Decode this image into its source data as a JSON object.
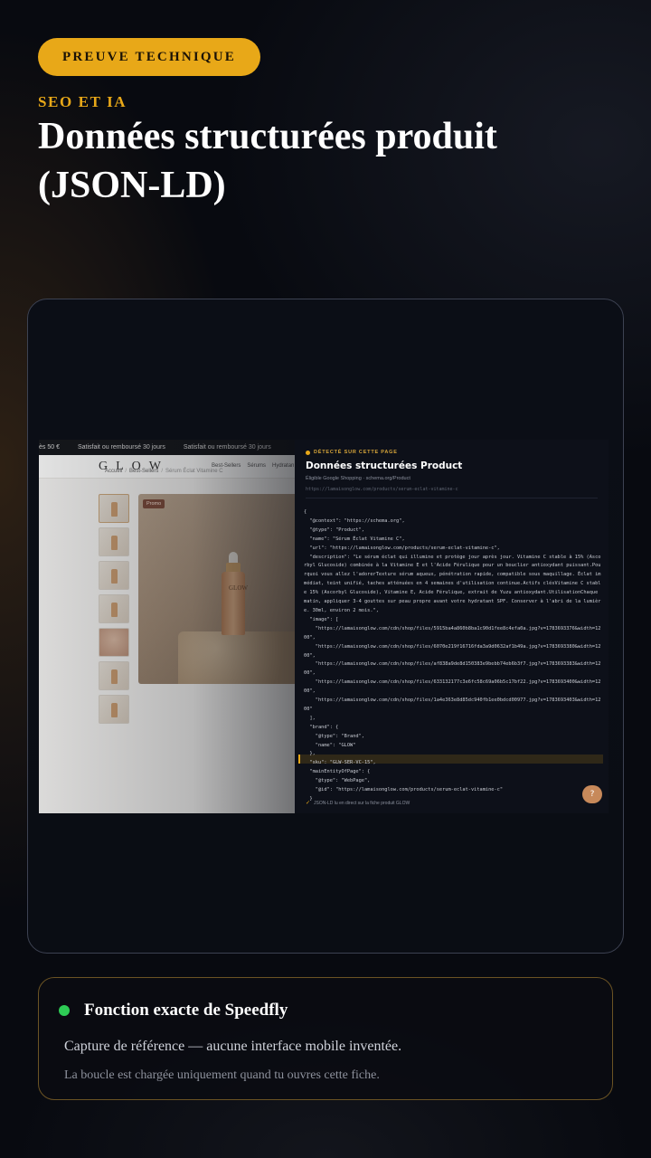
{
  "header": {
    "pill": "PREUVE TECHNIQUE",
    "eyebrow": "SEO ET IA",
    "title": "Données structurées produit (JSON-LD)"
  },
  "site": {
    "announce": [
      "ès 50 €",
      "Satisfait ou remboursé 30 jours",
      "Satisfait ou remboursé 30 jours"
    ],
    "logo": "GLOW",
    "nav": [
      "Best-Sellers",
      "Sérums",
      "Hydratan"
    ],
    "breadcrumb": [
      "Accueil",
      "Best-Sellers",
      "Sérum Éclat Vitamine C"
    ],
    "promo_badge": "Promo",
    "bottle_label": "GLOW"
  },
  "panel": {
    "detected_label": "DÉTECTÉ SUR CETTE PAGE",
    "title": "Données structurées Product",
    "subtitle": "Éligible Google Shopping · schema.org/Product",
    "url": "https://lamaisonglow.com/products/serum-eclat-vitamine-c",
    "json_text": "{\n  \"@context\": \"https://schema.org\",\n  \"@type\": \"Product\",\n  \"name\": \"Sérum Éclat Vitamine C\",\n  \"url\": \"https://lamaisonglow.com/products/serum-eclat-vitamine-c\",\n  \"description\": \"Le sérum éclat qui illumine et protège jour après jour. Vitamine C stable à 15% (Ascorbyl Glucoside) combinée à la Vitamine E et l'Acide Férulique pour un bouclier antioxydant puissant.Pourquoi vous allez l'adorerTexture sérum aqueux, pénétration rapide, compatible sous maquillage. Éclat immédiat, teint unifié, taches atténuées en 4 semaines d'utilisation continue.Actifs clésVitamine C stable 15% (Ascorbyl Glucoside), Vitamine E, Acide Férulique, extrait de Yuzu antioxydant.UtilisationChaque matin, appliquer 3-4 gouttes sur peau propre avant votre hydratant SPF. Conserver à l'abri de la lumière. 30ml, environ 2 mois.\",\n  \"image\": [\n    \"https://lamaisonglow.com/cdn/shop/files/5915ba4a860b8ba1c90d1fee8c4efa0a.jpg?v=1783693376&width=1200\",\n    \"https://lamaisonglow.com/cdn/shop/files/6070e219f16716fda3a9d0632af1b49a.jpg?v=1783693380&width=1200\",\n    \"https://lamaisonglow.com/cdn/shop/files/af838a9de8d150383e9bebb74eb6b3f7.jpg?v=1783693383&width=1200\",\n    \"https://lamaisonglow.com/cdn/shop/files/633132177c3e6fc58c69a06b5c17bf22.jpg?v=1783693400&width=1200\",\n    \"https://lamaisonglow.com/cdn/shop/files/1a4e363e8d85dc940fb1ee0bdcd00977.jpg?v=1783693403&width=1200\"\n  ],\n  \"brand\": {\n    \"@type\": \"Brand\",\n    \"name\": \"GLOW\"\n  },\n  \"sku\": \"GLW-SER-VC-15\",\n  \"mainEntityOfPage\": {\n    \"@type\": \"WebPage\",\n    \"@id\": \"https://lamaisonglow.com/products/serum-eclat-vitamine-c\"\n  }",
    "footer_note": "JSON-LD lu en direct sur la fiche produit GLOW",
    "help_icon": "?"
  },
  "card": {
    "title": "Fonction exacte de Speedfly",
    "line1": "Capture de référence — aucune interface mobile inventée.",
    "line2": "La boucle est chargée uniquement quand tu ouvres cette fiche."
  },
  "colors": {
    "accent": "#e8a818",
    "status_green": "#2ecc55",
    "background": "#080a10"
  }
}
